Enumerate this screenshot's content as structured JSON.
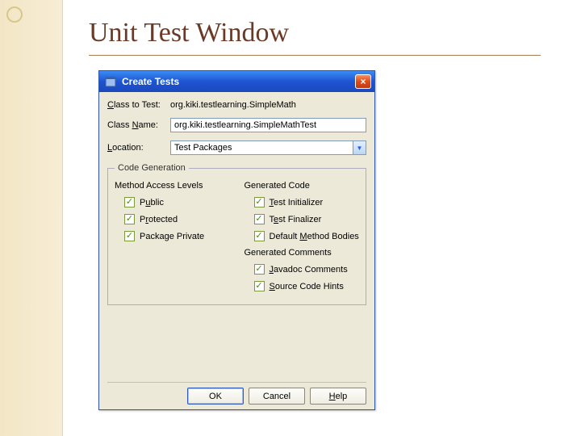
{
  "slide": {
    "title": "Unit Test Window"
  },
  "dialog": {
    "title": "Create Tests",
    "close": "×",
    "fields": {
      "classToTest": {
        "label": "Class to Test:",
        "value": "org.kiki.testlearning.SimpleMath"
      },
      "className": {
        "label": "Class Name:",
        "value": "org.kiki.testlearning.SimpleMathTest"
      },
      "location": {
        "label": "Location:",
        "value": "Test Packages"
      }
    },
    "codegen": {
      "legend": "Code Generation",
      "accessHeader": "Method Access Levels",
      "generatedCodeHeader": "Generated Code",
      "generatedCommentsHeader": "Generated Comments",
      "options": {
        "public": "Public",
        "protected": "Protected",
        "packagePrivate": "Package Private",
        "testInit": "Test Initializer",
        "testFinal": "Test Finalizer",
        "defaultBodies": "Default Method Bodies",
        "javadoc": "Javadoc Comments",
        "sourceHints": "Source Code Hints"
      }
    },
    "buttons": {
      "ok": "OK",
      "cancel": "Cancel",
      "help": "Help"
    }
  }
}
